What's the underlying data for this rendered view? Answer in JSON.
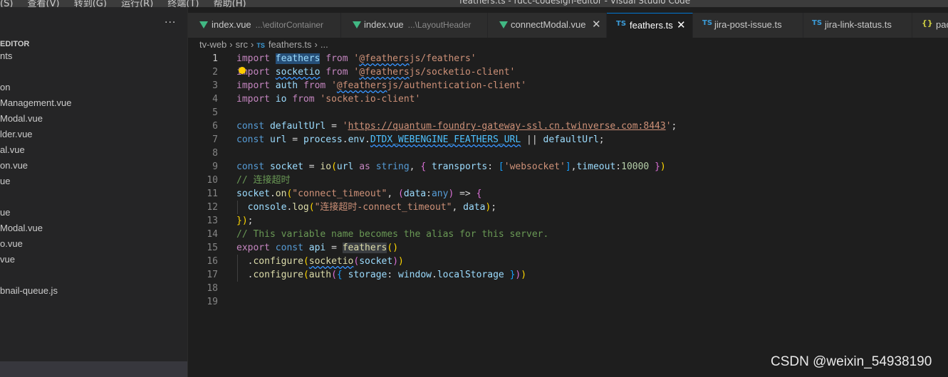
{
  "window": {
    "title": "feathers.ts - rdcc-codesign-editor - Visual Studio Code",
    "menu": [
      "(S)",
      "查看(V)",
      "转到(G)",
      "运行(R)",
      "终端(T)",
      "帮助(H)"
    ]
  },
  "sidebar": {
    "more": "···",
    "section": "EDITOR",
    "items": [
      "nts",
      "on",
      "Management.vue",
      "Modal.vue",
      "lder.vue",
      "al.vue",
      "on.vue",
      "ue",
      "ue",
      "Modal.vue",
      "o.vue",
      "vue",
      "bnail-queue.js"
    ]
  },
  "tabs": [
    {
      "icon": "vue-icon",
      "label": "index.vue",
      "desc": "...\\editorContainer",
      "active": false
    },
    {
      "icon": "vue-icon",
      "label": "index.vue",
      "desc": "...\\LayoutHeader",
      "active": false
    },
    {
      "icon": "vue-icon",
      "label": "connectModal.vue",
      "desc": "",
      "active": false,
      "close": "✕"
    },
    {
      "icon": "TS",
      "label": "feathers.ts",
      "desc": "",
      "active": true,
      "close": "✕"
    },
    {
      "icon": "TS",
      "label": "jira-post-issue.ts",
      "desc": "",
      "active": false
    },
    {
      "icon": "TS",
      "label": "jira-link-status.ts",
      "desc": "",
      "active": false
    },
    {
      "icon": "{}",
      "label": "pac",
      "desc": "",
      "active": false
    }
  ],
  "breadcrumb": {
    "parts": [
      "tv-web",
      "src",
      "feathers.ts",
      "..."
    ],
    "file_icon": "TS"
  },
  "editor": {
    "line_numbers": [
      "1",
      "2",
      "3",
      "4",
      "5",
      "6",
      "7",
      "8",
      "9",
      "10",
      "11",
      "12",
      "13",
      "14",
      "15",
      "16",
      "17",
      "18",
      "19"
    ],
    "lines": [
      "import feathers from '@feathersjs/feathers'",
      "import socketio from '@feathersjs/socketio-client'",
      "import auth from '@feathersjs/authentication-client'",
      "import io from 'socket.io-client'",
      "",
      "const defaultUrl = 'https://quantum-foundry-gateway-ssl.cn.twinverse.com:8443';",
      "const url = process.env.DTDX_WEBENGINE_FEATHERS_URL || defaultUrl;",
      "",
      "const socket = io(url as string, { transports: ['websocket'],timeout:10000 })",
      "// 连接超时",
      "socket.on(\"connect_timeout\", (data:any) => {",
      "  console.log(\"连接超时-connect_timeout\", data);",
      "});",
      "// This variable name becomes the alias for this server.",
      "export const api = feathers()",
      "  .configure(socketio(socket))",
      "  .configure(auth({ storage: window.localStorage }))",
      "",
      ""
    ]
  },
  "watermark": "CSDN @weixin_54938190",
  "colors": {
    "background": "#1e1e1e",
    "accent": "#0078d4",
    "keyword": "#c586c0",
    "string": "#ce9178",
    "variable": "#9cdcfe",
    "comment": "#6a9955"
  }
}
